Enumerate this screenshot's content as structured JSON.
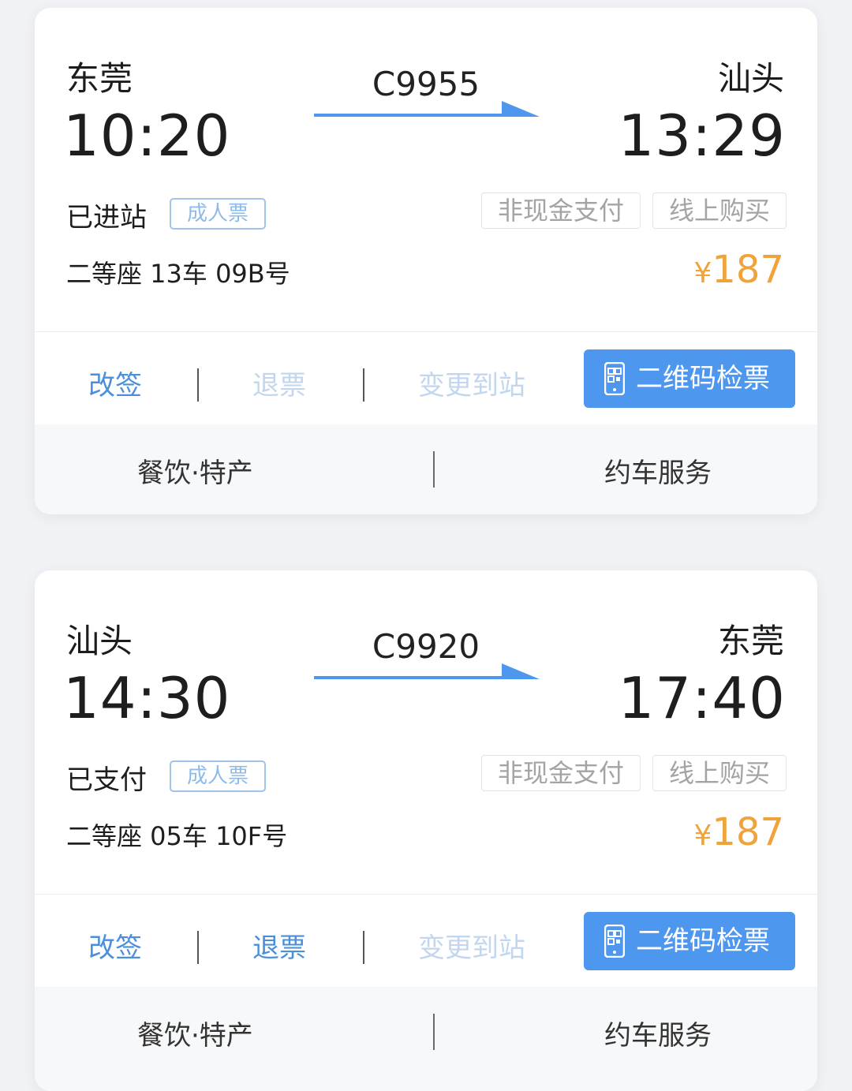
{
  "tickets": [
    {
      "from_station": "东莞",
      "to_station": "汕头",
      "train_no": "C9955",
      "depart_time": "10:20",
      "arrive_time": "13:29",
      "status": "已进站",
      "ticket_type": "成人票",
      "payment_tag": "非现金支付",
      "purchase_tag": "线上购买",
      "seat": "二等座 13车 09B号",
      "price_symbol": "¥",
      "price": "187",
      "actions": {
        "change": "改签",
        "refund": "退票",
        "change_station": "变更到站",
        "qr_check": "二维码检票",
        "refund_enabled": false
      },
      "services": {
        "food": "餐饮·特产",
        "car": "约车服务"
      }
    },
    {
      "from_station": "汕头",
      "to_station": "东莞",
      "train_no": "C9920",
      "depart_time": "14:30",
      "arrive_time": "17:40",
      "status": "已支付",
      "ticket_type": "成人票",
      "payment_tag": "非现金支付",
      "purchase_tag": "线上购买",
      "seat": "二等座 05车 10F号",
      "price_symbol": "¥",
      "price": "187",
      "actions": {
        "change": "改签",
        "refund": "退票",
        "change_station": "变更到站",
        "qr_check": "二维码检票",
        "refund_enabled": true
      },
      "services": {
        "food": "餐饮·特产",
        "car": "约车服务"
      }
    }
  ],
  "colors": {
    "accent_blue": "#4d97ee",
    "price_orange": "#f0a33a",
    "disabled_blue": "#c2d6ee"
  },
  "icons": [
    "arrow-right-icon",
    "phone-qr-icon"
  ]
}
